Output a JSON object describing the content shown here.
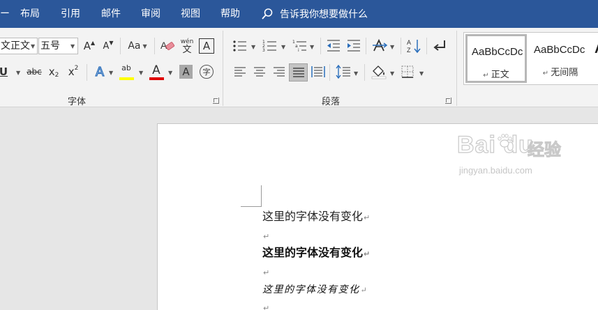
{
  "tabs": {
    "edge_label": "ー",
    "items": [
      "布局",
      "引用",
      "邮件",
      "审阅",
      "视图",
      "帮助"
    ],
    "tell_me": "告诉我你想要做什么"
  },
  "font_group": {
    "font_name": "文正文",
    "font_size": "五号",
    "grow_font": "A",
    "shrink_font": "A",
    "change_case": "Aa",
    "phonetic_top": "wén",
    "phonetic_bottom": "文",
    "char_border": "A",
    "underline": "U",
    "strikethrough": "abc",
    "subscript_base": "x",
    "subscript_mark": "2",
    "superscript_base": "x",
    "superscript_mark": "2",
    "text_effects": "A",
    "highlight": "ab",
    "font_color": "A",
    "char_shading": "A",
    "enclose_char": "字",
    "label": "字体"
  },
  "paragraph_group": {
    "label": "段落"
  },
  "styles": [
    {
      "sample": "AaBbCcDc",
      "name": "正文"
    },
    {
      "sample": "AaBbCcDc",
      "name": "无间隔"
    },
    {
      "sample": "A",
      "name": ""
    }
  ],
  "document": {
    "line1": "这里的字体没有变化",
    "line2": "这里的字体没有变化",
    "line3": "这里的字体没有变化",
    "para_mark": "↵"
  },
  "watermark": {
    "logo": "Bai du",
    "cn": "经验",
    "url": "jingyan.baidu.com"
  },
  "colors": {
    "tab_bar": "#2b579a",
    "highlight": "#ffff00",
    "font_color": "#e00000",
    "text_effects": "#2a6ebb"
  }
}
